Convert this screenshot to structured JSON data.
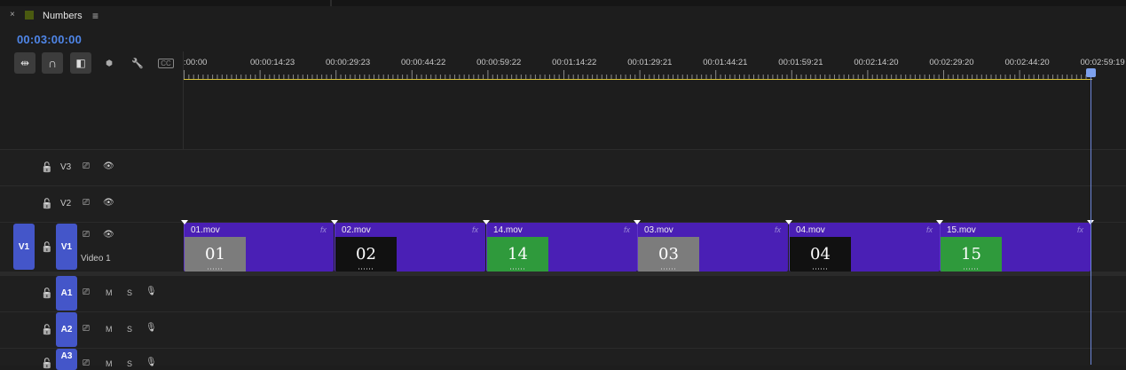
{
  "panel": {
    "close_glyph": "×",
    "sequence_name": "Numbers",
    "menu_glyph": "≡",
    "timecode": "00:03:00:00",
    "sequence_color": "#4a5a10"
  },
  "toolbar": {
    "tools": [
      {
        "icon": "insert-overwrite-icon",
        "glyph": "⇹"
      },
      {
        "icon": "snap-magnet-icon",
        "glyph": "∩"
      },
      {
        "icon": "linked-selection-icon",
        "glyph": "◧"
      },
      {
        "icon": "add-marker-icon",
        "glyph": "⬢"
      },
      {
        "icon": "wrench-settings-icon",
        "glyph": "🔧"
      },
      {
        "icon": "captions-icon",
        "glyph": "CC"
      }
    ]
  },
  "ruler": {
    "labels": [
      ":00:00",
      "00:00:14:23",
      "00:00:29:23",
      "00:00:44:22",
      "00:00:59:22",
      "00:01:14:22",
      "00:01:29:21",
      "00:01:44:21",
      "00:01:59:21",
      "00:02:14:20",
      "00:02:29:20",
      "00:02:44:20",
      "00:02:59:19"
    ],
    "work_area_color": "#d8c43a"
  },
  "tracks": {
    "video": [
      {
        "name": "V3",
        "lock_glyph": "🔓",
        "film_glyph": "⎚",
        "eye_glyph": "👁"
      },
      {
        "name": "V2",
        "lock_glyph": "🔓",
        "film_glyph": "⎚",
        "eye_glyph": "👁"
      },
      {
        "name": "V1",
        "label": "Video 1",
        "source": "V1",
        "lock_glyph": "🔓",
        "film_glyph": "⎚",
        "eye_glyph": "👁"
      }
    ],
    "audio": [
      {
        "name": "A1",
        "lock_glyph": "🔓",
        "film_glyph": "⎚",
        "mute": "M",
        "solo": "S",
        "mic_glyph": "🎙"
      },
      {
        "name": "A2",
        "lock_glyph": "🔓",
        "film_glyph": "⎚",
        "mute": "M",
        "solo": "S",
        "mic_glyph": "🎙"
      },
      {
        "name": "A3",
        "lock_glyph": "🔓",
        "film_glyph": "⎚",
        "mute": "M",
        "solo": "S",
        "mic_glyph": "🎙"
      }
    ],
    "track_color": "#4456c9"
  },
  "clips": [
    {
      "name": "01.mov",
      "number": "01",
      "thumb_color": "#7c7c7c",
      "fx": "fx"
    },
    {
      "name": "02.mov",
      "number": "02",
      "thumb_color": "#111111",
      "fx": "fx"
    },
    {
      "name": "14.mov",
      "number": "14",
      "thumb_color": "#2f9a3c",
      "fx": "fx"
    },
    {
      "name": "03.mov",
      "number": "03",
      "thumb_color": "#7c7c7c",
      "fx": "fx"
    },
    {
      "name": "04.mov",
      "number": "04",
      "thumb_color": "#111111",
      "fx": "fx"
    },
    {
      "name": "15.mov",
      "number": "15",
      "thumb_color": "#2f9a3c",
      "fx": "fx"
    }
  ],
  "clip_color": "#4a1fb5",
  "playhead_color": "#7da1ee"
}
